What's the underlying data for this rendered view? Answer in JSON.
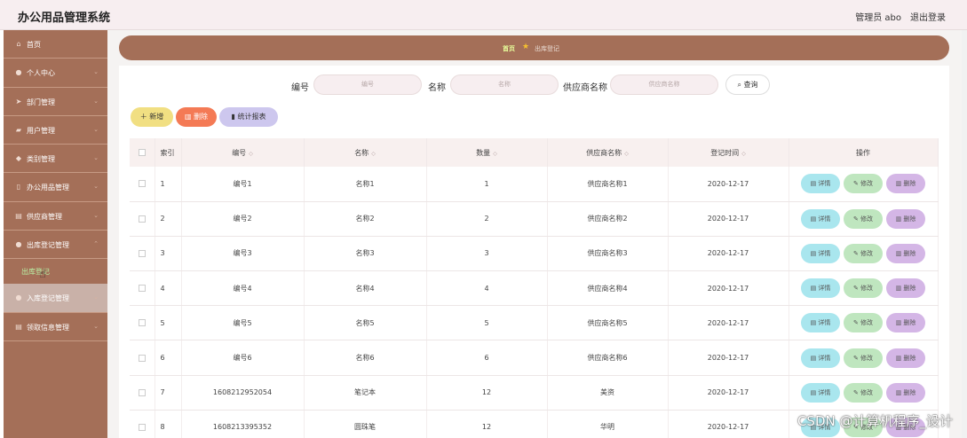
{
  "header": {
    "title": "办公用品管理系统",
    "user": "管理员 abo",
    "logout": "退出登录"
  },
  "sidebar": {
    "items": [
      {
        "label": "首页",
        "icon": "home-icon",
        "glyph": "⌂",
        "chevron": ""
      },
      {
        "label": "个人中心",
        "icon": "user-icon",
        "glyph": "●",
        "chevron": "⌄"
      },
      {
        "label": "部门管理",
        "icon": "send-icon",
        "glyph": "➤",
        "chevron": "⌄"
      },
      {
        "label": "用户管理",
        "icon": "folder-icon",
        "glyph": "▰",
        "chevron": "⌄"
      },
      {
        "label": "类别管理",
        "icon": "tag-icon",
        "glyph": "◆",
        "chevron": "⌄"
      },
      {
        "label": "办公用品管理",
        "icon": "doc-icon",
        "glyph": "▯",
        "chevron": "⌄"
      },
      {
        "label": "供应商管理",
        "icon": "grid-icon",
        "glyph": "▤",
        "chevron": "⌄"
      },
      {
        "label": "出库登记管理",
        "icon": "user-icon",
        "glyph": "●",
        "chevron": "⌃"
      }
    ],
    "sub_item": "出库登记",
    "items_after": [
      {
        "label": "入库登记管理",
        "icon": "user-icon",
        "glyph": "●",
        "chevron": "⌄"
      },
      {
        "label": "领取信息管理",
        "icon": "list-icon",
        "glyph": "▤",
        "chevron": "⌄"
      }
    ]
  },
  "breadcrumb": {
    "home": "首页",
    "current": "出库登记"
  },
  "search": {
    "fields": [
      {
        "label": "编号",
        "placeholder": "编号"
      },
      {
        "label": "名称",
        "placeholder": "名称"
      },
      {
        "label": "供应商名称",
        "placeholder": "供应商名称"
      }
    ],
    "button": "查询"
  },
  "toolbar": {
    "add": "新增",
    "delete": "删除",
    "stats": "统计报表"
  },
  "table": {
    "columns": [
      "索引",
      "编号",
      "名称",
      "数量",
      "供应商名称",
      "登记时间",
      "操作"
    ],
    "ops": {
      "detail": "详情",
      "edit": "修改",
      "delete": "删除"
    },
    "rows": [
      {
        "idx": "1",
        "code": "编号1",
        "name": "名称1",
        "qty": "1",
        "supplier": "供应商名称1",
        "date": "2020-12-17"
      },
      {
        "idx": "2",
        "code": "编号2",
        "name": "名称2",
        "qty": "2",
        "supplier": "供应商名称2",
        "date": "2020-12-17"
      },
      {
        "idx": "3",
        "code": "编号3",
        "name": "名称3",
        "qty": "3",
        "supplier": "供应商名称3",
        "date": "2020-12-17"
      },
      {
        "idx": "4",
        "code": "编号4",
        "name": "名称4",
        "qty": "4",
        "supplier": "供应商名称4",
        "date": "2020-12-17"
      },
      {
        "idx": "5",
        "code": "编号5",
        "name": "名称5",
        "qty": "5",
        "supplier": "供应商名称5",
        "date": "2020-12-17"
      },
      {
        "idx": "6",
        "code": "编号6",
        "name": "名称6",
        "qty": "6",
        "supplier": "供应商名称6",
        "date": "2020-12-17"
      },
      {
        "idx": "7",
        "code": "1608212952054",
        "name": "笔记本",
        "qty": "12",
        "supplier": "美资",
        "date": "2020-12-17"
      },
      {
        "idx": "8",
        "code": "1608213395352",
        "name": "圆珠笔",
        "qty": "12",
        "supplier": "华明",
        "date": "2020-12-17"
      }
    ]
  },
  "watermark": "CSDN @计算机程序_设计",
  "colors": {
    "sidebar": "#a46f58",
    "accent_active": "#b9f2a6",
    "add": "#f1df82",
    "delete": "#f47a55",
    "stats": "#cdc7ee"
  }
}
